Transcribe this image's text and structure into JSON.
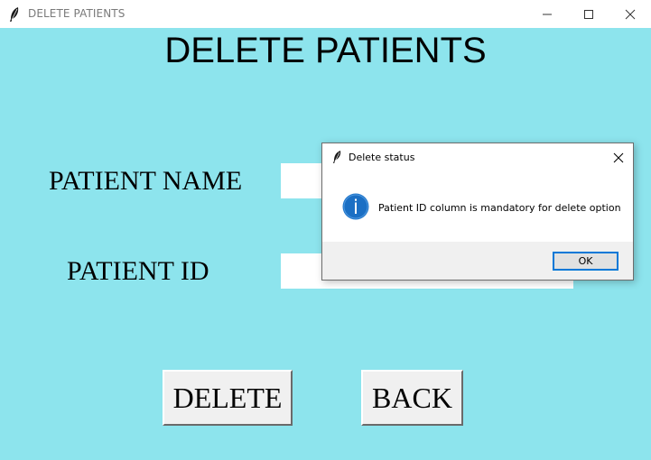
{
  "window": {
    "title": "DELETE PATIENTS",
    "icon": "feather-icon",
    "background_color": "#8de4ed"
  },
  "page": {
    "heading": "DELETE PATIENTS"
  },
  "form": {
    "patient_name_label": "PATIENT NAME",
    "patient_name_value": "",
    "patient_id_label": "PATIENT ID",
    "patient_id_value": ""
  },
  "buttons": {
    "delete_label": "DELETE",
    "back_label": "BACK"
  },
  "dialog": {
    "title": "Delete status",
    "icon": "info-icon",
    "message": "Patient ID column is mandatory for delete option",
    "ok_label": "OK",
    "accent_color": "#0078d7"
  }
}
